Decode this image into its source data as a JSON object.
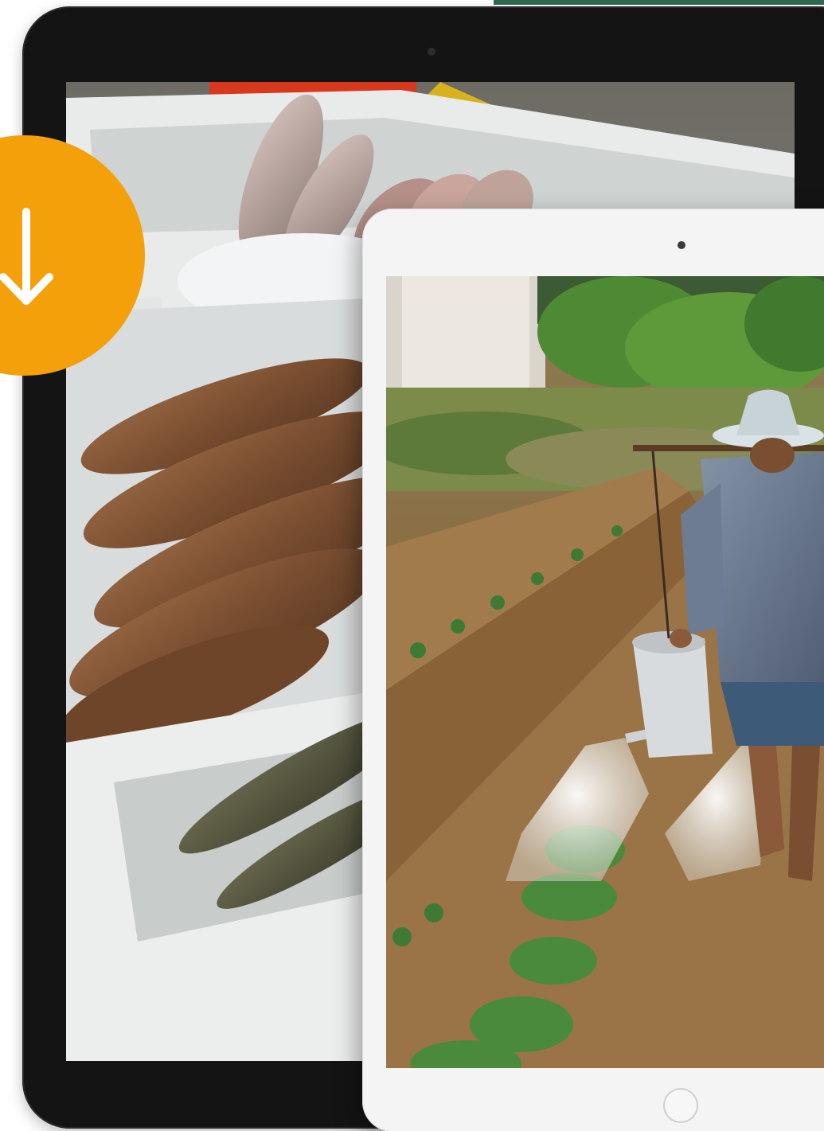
{
  "colors": {
    "accent_green": "#2f6b4f",
    "download_orange": "#f4a00b",
    "tablet_dark": "#141414",
    "tablet_light": "#f4f4f4"
  },
  "download_button": {
    "icon": "arrow-down-icon"
  },
  "devices": [
    {
      "type": "tablet",
      "finish": "black",
      "screen_image": "fish-in-styrofoam-crates-photo"
    },
    {
      "type": "tablet",
      "finish": "white",
      "screen_image": "farmer-watering-crops-photo"
    }
  ]
}
